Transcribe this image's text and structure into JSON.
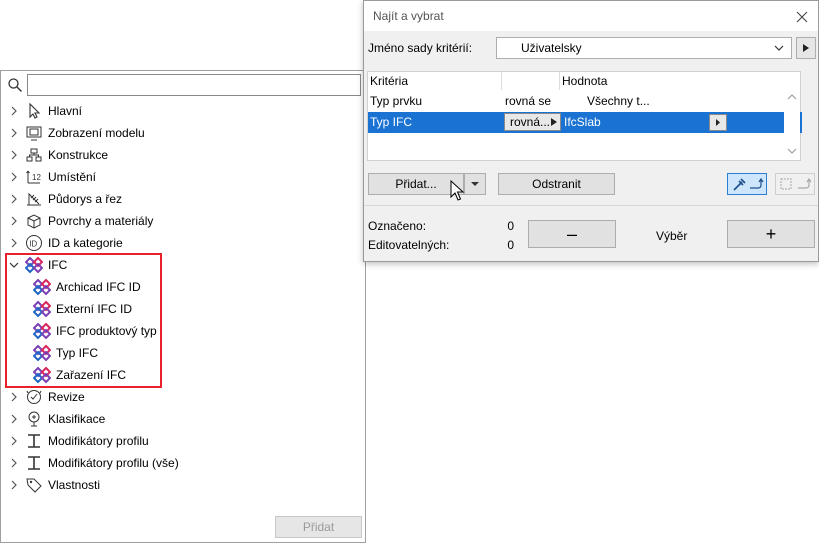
{
  "tree": {
    "search": {
      "value": "",
      "placeholder": ""
    },
    "items": [
      {
        "label": "Hlavní",
        "icon": "arrow-pointer-icon"
      },
      {
        "label": "Zobrazení modelu",
        "icon": "model-view-icon"
      },
      {
        "label": "Konstrukce",
        "icon": "structure-icon"
      },
      {
        "label": "Umístění",
        "icon": "placement-icon"
      },
      {
        "label": "Půdorys a řez",
        "icon": "floorplan-section-icon"
      },
      {
        "label": "Povrchy a materiály",
        "icon": "surfaces-icon"
      },
      {
        "label": "ID a kategorie",
        "icon": "id-icon"
      },
      {
        "label": "IFC",
        "icon": "ifc-icon"
      },
      {
        "label": "Revize",
        "icon": "revision-icon"
      },
      {
        "label": "Klasifikace",
        "icon": "classification-icon"
      },
      {
        "label": "Modifikátory profilu",
        "icon": "profile-icon"
      },
      {
        "label": "Modifikátory profilu (vše)",
        "icon": "profile-icon"
      },
      {
        "label": "Vlastnosti",
        "icon": "tag-icon"
      }
    ],
    "ifc_children": [
      {
        "label": "Archicad IFC ID"
      },
      {
        "label": "Externí IFC ID"
      },
      {
        "label": "IFC produktový typ"
      },
      {
        "label": "Typ IFC"
      },
      {
        "label": "Zařazení IFC"
      }
    ],
    "add_button": "Přidat",
    "highlight_color": "#e8222b"
  },
  "dialog": {
    "title": "Najít a vybrat",
    "criteria_name_label": "Jméno sady kritérií:",
    "criteria_name_value": "Uživatelsky",
    "table": {
      "headers": [
        "Kritéria",
        "",
        "Hodnota"
      ],
      "rows": [
        {
          "criterion": "Typ prvku",
          "operator": "rovná se",
          "value": "Všechny t..."
        },
        {
          "criterion": "Typ IFC",
          "operator": "rovná...",
          "value": "IfcSlab",
          "selected": true
        }
      ]
    },
    "add_button": "Přidat...",
    "remove_button": "Odstranit",
    "marked_label": "Označeno:",
    "marked_value": "0",
    "editable_label": "Editovatelných:",
    "editable_value": "0",
    "minus_label": "–",
    "plus_label": "+",
    "selection_label": "Výběr",
    "accent_color": "#1a73d2"
  }
}
